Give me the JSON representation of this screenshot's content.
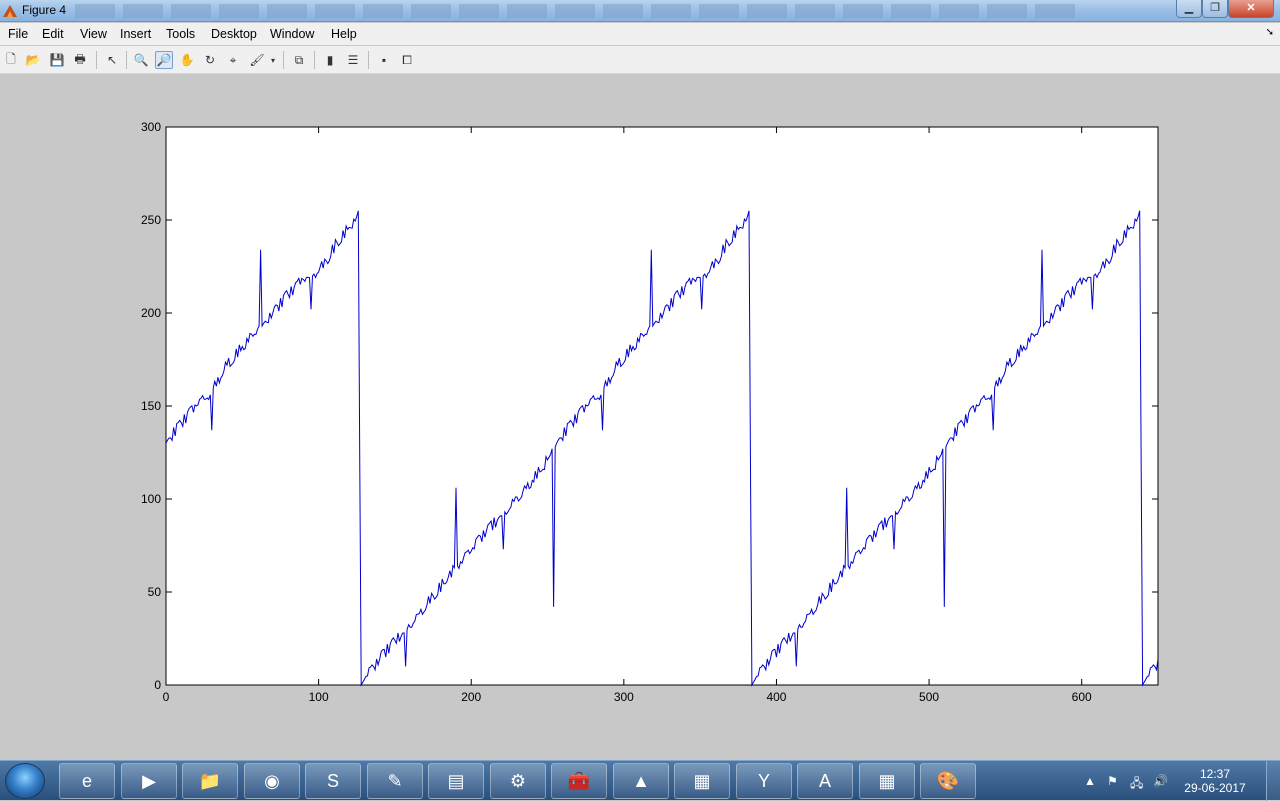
{
  "window": {
    "title": "Figure 4",
    "min_label": "▁",
    "max_label": "❐",
    "close_label": "✕"
  },
  "menu": [
    "File",
    "Edit",
    "View",
    "Insert",
    "Tools",
    "Desktop",
    "Window",
    "Help"
  ],
  "toolbar": [
    {
      "name": "new-figure-icon",
      "glyph": "🗋"
    },
    {
      "name": "open-file-icon",
      "glyph": "📂"
    },
    {
      "name": "save-icon",
      "glyph": "💾"
    },
    {
      "name": "print-icon",
      "glyph": "🖶"
    },
    {
      "name": "edit-plot-icon",
      "glyph": "↖"
    },
    {
      "name": "zoom-in-icon",
      "glyph": "🔍"
    },
    {
      "name": "zoom-out-icon",
      "glyph": "🔎"
    },
    {
      "name": "pan-icon",
      "glyph": "✋"
    },
    {
      "name": "rotate-3d-icon",
      "glyph": "↻"
    },
    {
      "name": "data-cursor-icon",
      "glyph": "⌖"
    },
    {
      "name": "brush-icon",
      "glyph": "🖌"
    },
    {
      "name": "link-plot-icon",
      "glyph": "⧉"
    },
    {
      "name": "insert-colorbar-icon",
      "glyph": "▮"
    },
    {
      "name": "insert-legend-icon",
      "glyph": "☰"
    },
    {
      "name": "hide-plot-tools-icon",
      "glyph": "▪"
    },
    {
      "name": "show-plot-tools-icon",
      "glyph": "⧠"
    }
  ],
  "chart_data": {
    "type": "line",
    "title": "",
    "xlabel": "",
    "ylabel": "",
    "xlim": [
      0,
      650
    ],
    "ylim": [
      0,
      300
    ],
    "xticks": [
      0,
      100,
      200,
      300,
      400,
      500,
      600
    ],
    "yticks": [
      0,
      50,
      100,
      150,
      200,
      250,
      300
    ],
    "grid": false,
    "color": "#0000cc",
    "series": [
      {
        "period": 256,
        "base_points": [
          [
            0,
            130
          ],
          [
            10,
            141
          ],
          [
            20,
            150
          ],
          [
            29,
            156
          ],
          [
            30,
            137
          ],
          [
            31,
            160
          ],
          [
            40,
            172
          ],
          [
            50,
            182
          ],
          [
            61,
            193
          ],
          [
            62,
            234
          ],
          [
            63,
            193
          ],
          [
            70,
            200
          ],
          [
            80,
            210
          ],
          [
            90,
            218
          ],
          [
            94,
            219
          ],
          [
            95,
            202
          ],
          [
            96,
            220
          ],
          [
            105,
            228
          ],
          [
            112,
            238
          ],
          [
            120,
            246
          ],
          [
            125,
            252
          ],
          [
            126,
            255
          ],
          [
            127,
            116
          ],
          [
            127.9,
            0
          ],
          [
            130,
            3
          ],
          [
            140,
            14
          ],
          [
            150,
            24
          ],
          [
            156,
            28
          ],
          [
            157,
            10
          ],
          [
            158,
            30
          ],
          [
            165,
            38
          ],
          [
            175,
            48
          ],
          [
            185,
            58
          ],
          [
            189,
            63
          ],
          [
            190,
            106
          ],
          [
            191,
            64
          ],
          [
            200,
            72
          ],
          [
            210,
            83
          ],
          [
            220,
            91
          ],
          [
            221,
            73
          ],
          [
            222,
            93
          ],
          [
            230,
            101
          ],
          [
            240,
            110
          ],
          [
            250,
            121
          ],
          [
            252,
            124
          ],
          [
            253,
            127
          ],
          [
            254,
            42
          ],
          [
            255,
            128
          ],
          [
            256,
            130
          ]
        ],
        "x_end": 650,
        "noise_amplitude": 3,
        "note_chart": "sawtooth-like signal from 0 to ~255 repeating every 256 samples"
      }
    ]
  },
  "taskbar": {
    "apps": [
      {
        "name": "internet-explorer-icon",
        "glyph": "e"
      },
      {
        "name": "media-player-icon",
        "glyph": "▶"
      },
      {
        "name": "file-explorer-icon",
        "glyph": "📁"
      },
      {
        "name": "chrome-icon",
        "glyph": "◉"
      },
      {
        "name": "skype-icon",
        "glyph": "S"
      },
      {
        "name": "notepad-plus-icon",
        "glyph": "✎"
      },
      {
        "name": "notebook-icon",
        "glyph": "▤"
      },
      {
        "name": "control-panel-icon",
        "glyph": "⚙"
      },
      {
        "name": "toolbox-icon",
        "glyph": "🧰"
      },
      {
        "name": "matlab-icon",
        "glyph": "▲"
      },
      {
        "name": "task-manager-icon",
        "glyph": "▦"
      },
      {
        "name": "app-y-icon",
        "glyph": "Y"
      },
      {
        "name": "acrobat-icon",
        "glyph": "A"
      },
      {
        "name": "calculator-icon",
        "glyph": "▦"
      },
      {
        "name": "paint-icon",
        "glyph": "🎨"
      }
    ],
    "tray": [
      {
        "name": "show-hidden-icons-icon",
        "glyph": "▲"
      },
      {
        "name": "action-center-icon",
        "glyph": "⚑"
      },
      {
        "name": "network-icon",
        "glyph": "🖧"
      },
      {
        "name": "volume-icon",
        "glyph": "🔊"
      }
    ],
    "time": "12:37",
    "date": "29-06-2017"
  }
}
